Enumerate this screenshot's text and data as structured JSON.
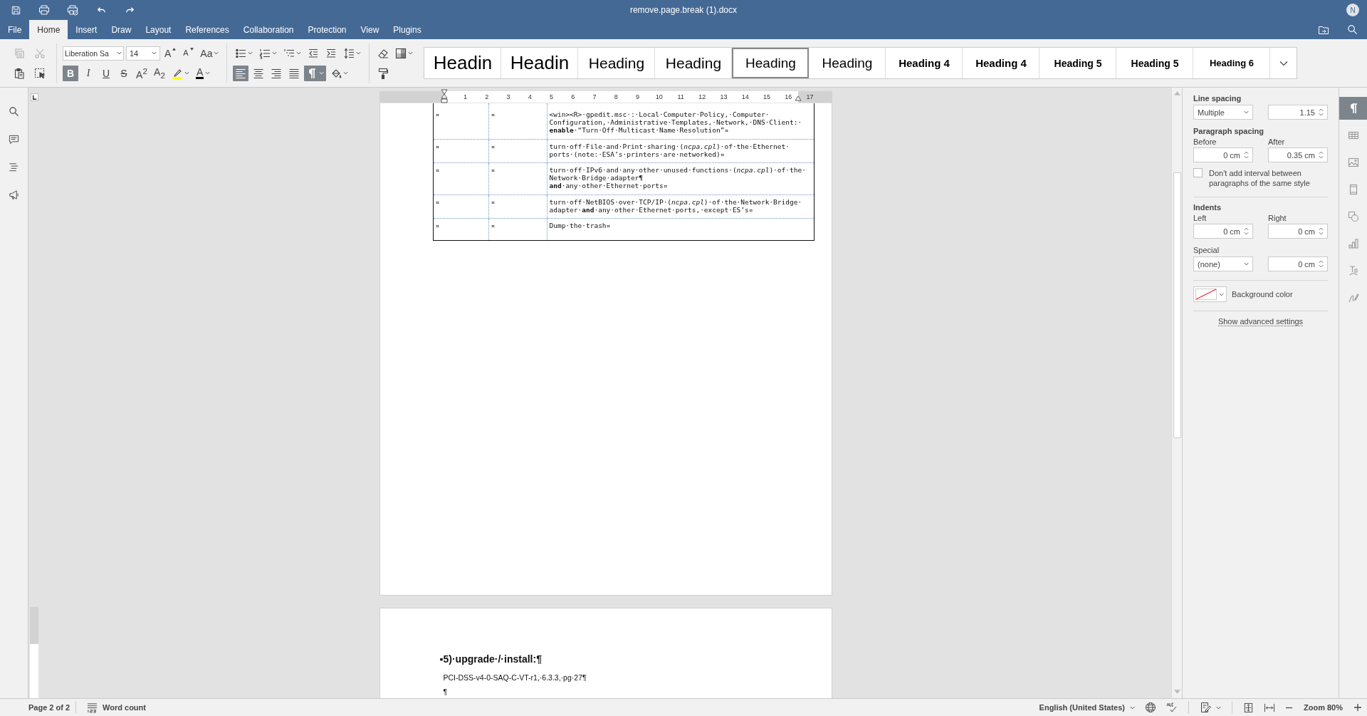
{
  "window": {
    "title": "remove.page.break (1).docx",
    "avatar": "N"
  },
  "tabs": [
    {
      "label": "File",
      "selected": false
    },
    {
      "label": "Home",
      "selected": true
    },
    {
      "label": "Insert",
      "selected": false
    },
    {
      "label": "Draw",
      "selected": false
    },
    {
      "label": "Layout",
      "selected": false
    },
    {
      "label": "References",
      "selected": false
    },
    {
      "label": "Collaboration",
      "selected": false
    },
    {
      "label": "Protection",
      "selected": false
    },
    {
      "label": "View",
      "selected": false
    },
    {
      "label": "Plugins",
      "selected": false
    }
  ],
  "toolbar": {
    "font_name": "Liberation Sa",
    "font_size": "14",
    "groups": [
      {
        "top": [
          {
            "kind": "copy",
            "disabled": true
          },
          {
            "kind": "cut",
            "disabled": true
          }
        ],
        "bottom": [
          {
            "kind": "paste",
            "disabled": false
          },
          {
            "kind": "select",
            "disabled": false
          }
        ]
      },
      {
        "top": [
          {
            "kind": "font-name"
          },
          {
            "kind": "font-size"
          },
          {
            "kind": "grow",
            "glyph": "A"
          },
          {
            "kind": "shrink",
            "glyph": "A"
          },
          {
            "kind": "case",
            "glyph": "Aa"
          }
        ],
        "bottom": [
          {
            "kind": "bold",
            "glyph": "B",
            "on": true
          },
          {
            "kind": "italic",
            "glyph": "I",
            "on": false
          },
          {
            "kind": "underline",
            "glyph": "U",
            "on": false
          },
          {
            "kind": "strike",
            "glyph": "S",
            "on": false
          },
          {
            "kind": "sup",
            "glyph": "A$^{2}$",
            "on": false
          },
          {
            "kind": "sub",
            "glyph": "A$_{2}$",
            "on": false
          },
          {
            "kind": "highlight",
            "on": false
          },
          {
            "kind": "font-color",
            "glyph": "A",
            "on": false
          }
        ]
      },
      {
        "top": [
          {
            "kind": "bullets"
          },
          {
            "kind": "numbering"
          },
          {
            "kind": "multilevel"
          },
          {
            "kind": "outdent"
          },
          {
            "kind": "indent"
          },
          {
            "kind": "line-spacing"
          }
        ],
        "bottom": [
          {
            "kind": "align-left",
            "on": true
          },
          {
            "kind": "align-center",
            "on": false
          },
          {
            "kind": "align-right",
            "on": false
          },
          {
            "kind": "justify",
            "on": false
          },
          {
            "kind": "marks",
            "on": true
          },
          {
            "kind": "shading",
            "on": false
          }
        ]
      },
      {
        "top": [
          {
            "kind": "eraser"
          },
          {
            "kind": "scheme"
          }
        ],
        "bottom": [
          {
            "kind": "painter"
          }
        ]
      }
    ],
    "styles": [
      {
        "label": "Headin",
        "kind": "title",
        "selected": false
      },
      {
        "label": "Headin",
        "kind": "title",
        "selected": false
      },
      {
        "label": "Heading",
        "kind": "h1",
        "selected": false
      },
      {
        "label": "Heading",
        "kind": "h1",
        "selected": false
      },
      {
        "label": "Heading",
        "kind": "h3",
        "selected": true
      },
      {
        "label": "Heading",
        "kind": "h3",
        "selected": false
      },
      {
        "label": "Heading 4",
        "kind": "h4",
        "selected": false
      },
      {
        "label": "Heading 4",
        "kind": "h4",
        "selected": false
      },
      {
        "label": "Heading 5",
        "kind": "h5",
        "selected": false
      },
      {
        "label": "Heading 5",
        "kind": "h5",
        "selected": false
      },
      {
        "label": "Heading 6",
        "kind": "h6",
        "selected": false
      }
    ]
  },
  "ruler": {
    "numbers": [
      "1",
      "2",
      "3",
      "4",
      "5",
      "6",
      "7",
      "8",
      "9",
      "10",
      "11",
      "12",
      "13",
      "14",
      "15",
      "16",
      "17"
    ]
  },
  "document": {
    "table_rows": [
      {
        "cells": [
          "¤",
          "¤"
        ],
        "lines": [
          "<win><R>·gpedit.msc·:·Local·Computer·Policy,·Computer·",
          "Configuration,·Administrative·Templates,·Network,·DNS·Client:·",
          "**enable**·“Turn·Off·Multicast·Name·Resolution”¤"
        ]
      },
      {
        "cells": [
          "¤",
          "¤"
        ],
        "lines": [
          "turn·off·File·and·Print·sharing·(*ncpa.cpl*)·of·the·Ethernet·",
          "ports·(note:·ESA’s·printers·are·networked)¤"
        ]
      },
      {
        "cells": [
          "¤",
          "¤"
        ],
        "lines": [
          "turn·off·IPv6·and·any·other·unused·functions·(*ncpa.cpl*)·of·the·",
          "Network·Bridge·adapter¶",
          "**and**·any·other·Ethernet·ports¤"
        ]
      },
      {
        "cells": [
          "¤",
          "¤"
        ],
        "lines": [
          "turn·off·NetBIOS·over·TCP/IP·(*ncpa.cpl*)·of·the·Network·Bridge·",
          "adapter·**and**·any·other·Ethernet·ports,·except·ES’s¤"
        ]
      },
      {
        "cells": [
          "¤",
          "¤"
        ],
        "lines": [
          "Dump·the·trash¤"
        ]
      }
    ],
    "page2": [
      {
        "kind": "heading",
        "text": "▪5)·upgrade·/·install:¶"
      },
      {
        "kind": "body",
        "text": "PCI-DSS-v4-0-SAQ-C-VT-r1,·6.3.3,·pg·27¶"
      },
      {
        "kind": "body",
        "text": "¶"
      }
    ]
  },
  "paragraph_panel": {
    "line_spacing_label": "Line spacing",
    "line_spacing_type": "Multiple",
    "line_spacing_value": "1.15",
    "paragraph_spacing_label": "Paragraph spacing",
    "before_label": "Before",
    "before": "0 cm",
    "after_label": "After",
    "after": "0.35 cm",
    "no_interval": {
      "label": "Don't add interval between paragraphs of the same style",
      "checked": false
    },
    "indents_label": "Indents",
    "left_label": "Left",
    "left": "0 cm",
    "right_label": "Right",
    "right": "0 cm",
    "special_label": "Special",
    "special": "(none)",
    "special_value": "0 cm",
    "background_label": "Background color",
    "advanced_link": "Show advanced settings"
  },
  "right_tabs": [
    {
      "kind": "paragraph",
      "selected": true
    },
    {
      "kind": "table",
      "selected": false
    },
    {
      "kind": "image",
      "selected": false
    },
    {
      "kind": "header",
      "selected": false
    },
    {
      "kind": "shape",
      "selected": false
    },
    {
      "kind": "chart",
      "selected": false
    },
    {
      "kind": "text-art",
      "selected": false
    },
    {
      "kind": "signature",
      "selected": false
    }
  ],
  "status_bar": {
    "page": "Page 2 of 2",
    "word_count": "Word count",
    "language": "English (United States)",
    "zoom": "Zoom 80%"
  }
}
